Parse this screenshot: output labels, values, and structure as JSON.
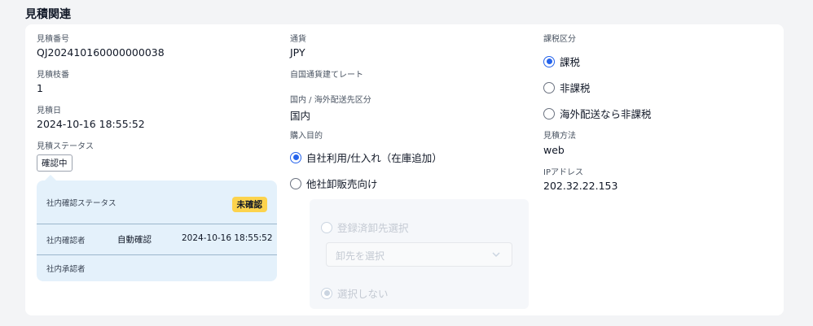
{
  "section_title": "見積関連",
  "left": {
    "quote_no": {
      "label": "見積番号",
      "value": "QJ202410160000000038"
    },
    "branch_no": {
      "label": "見積枝番",
      "value": "1"
    },
    "quote_date": {
      "label": "見積日",
      "value": "2024-10-16 18:55:52"
    },
    "quote_status": {
      "label": "見積ステータス",
      "value": "確認中"
    },
    "panel": {
      "internal_status_label": "社内確認ステータス",
      "internal_status_value": "未確認",
      "confirmer_label": "社内確認者",
      "confirmer_value": "自動確認",
      "confirmer_date": "2024-10-16 18:55:52",
      "approver_label": "社内承認者"
    }
  },
  "middle": {
    "currency": {
      "label": "通貨",
      "value": "JPY"
    },
    "exchange_rate": {
      "label": "自国通貨建てレート",
      "value": ""
    },
    "domestic": {
      "label": "国内 / 海外配送先区分",
      "value": "国内"
    },
    "purpose": {
      "label": "購入目的",
      "options": [
        "自社利用/仕入れ（在庫追加）",
        "他社卸販売向け"
      ],
      "selected": 0
    },
    "wholesale": {
      "registered_label": "登録済卸先選択",
      "select_placeholder": "卸先を選択",
      "none_label": "選択しない"
    }
  },
  "right": {
    "tax": {
      "label": "課税区分",
      "options": [
        "課税",
        "非課税",
        "海外配送なら非課税"
      ],
      "selected": 0
    },
    "method": {
      "label": "見積方法",
      "value": "web"
    },
    "ip": {
      "label": "IPアドレス",
      "value": "202.32.22.153"
    }
  }
}
